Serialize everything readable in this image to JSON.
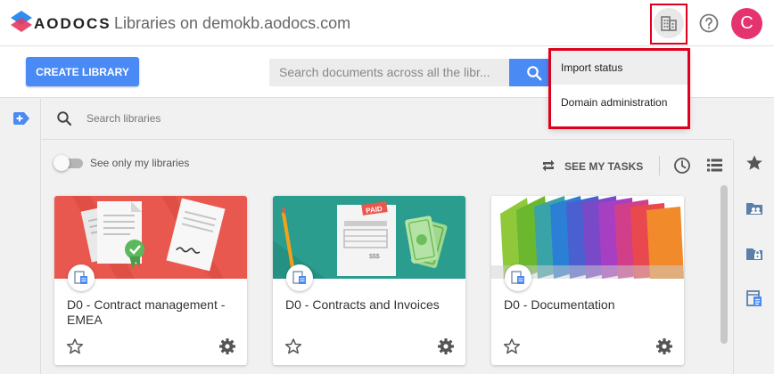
{
  "header": {
    "brand": "AODOCS",
    "title": "Libraries on demokb.aodocs.com",
    "avatar_letter": "C",
    "domain_icon": "building-icon",
    "help_icon": "help-circle-icon"
  },
  "toolbar": {
    "create_label": "CREATE LIBRARY",
    "search_placeholder": "Search documents across all the libr..."
  },
  "menu": {
    "items": [
      {
        "label": "Import status"
      },
      {
        "label": "Domain administration"
      }
    ]
  },
  "library_search": {
    "placeholder": "Search libraries"
  },
  "options": {
    "toggle_label": "See only my libraries",
    "tasks_label": "SEE MY TASKS"
  },
  "cards": [
    {
      "title": "D0 - Contract management - EMEA",
      "image": "contract-documents-image"
    },
    {
      "title": "D0 - Contracts and Invoices",
      "image": "invoice-money-image"
    },
    {
      "title": "D0 - Documentation",
      "image": "colorful-folders-image"
    }
  ],
  "colors": {
    "accent": "#4a8af4",
    "avatar": "#e4336f",
    "highlight": "#e0001b"
  }
}
